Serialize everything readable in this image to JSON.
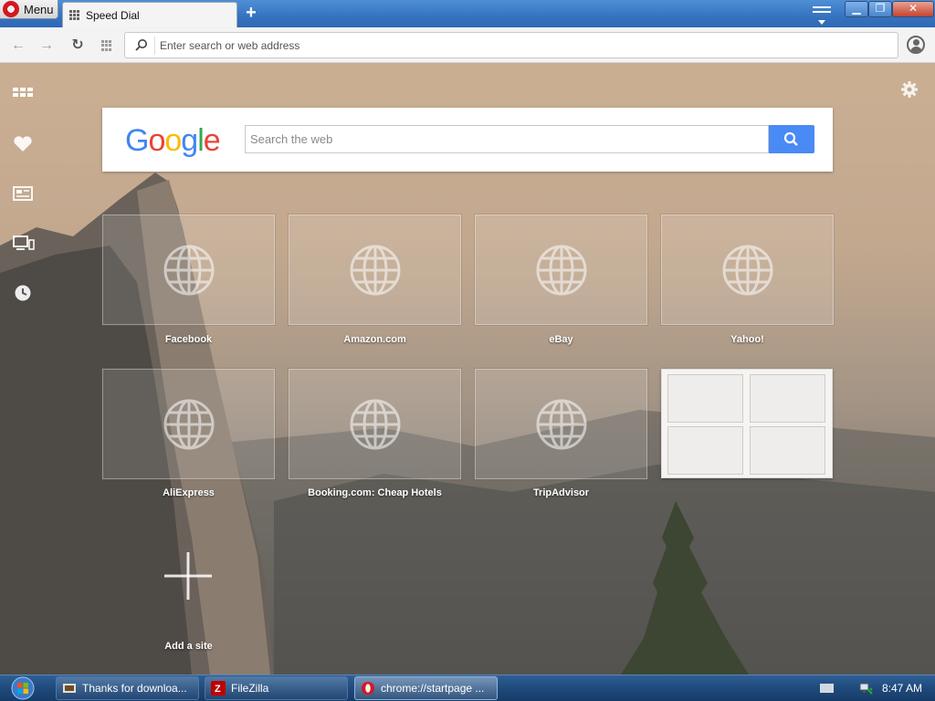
{
  "titlebar": {
    "menu_label": "Menu",
    "tab_title": "Speed Dial",
    "new_tab_symbol": "+",
    "window_buttons": {
      "minimize": "▁",
      "maximize": "❐",
      "close": "✕"
    }
  },
  "toolbar": {
    "back_symbol": "←",
    "forward_symbol": "→",
    "reload_symbol": "↻",
    "address_placeholder": "Enter search or web address"
  },
  "sidebar": {
    "items": [
      {
        "icon": "speed-dial-grid-icon"
      },
      {
        "icon": "heart-icon"
      },
      {
        "icon": "news-icon"
      },
      {
        "icon": "devices-icon"
      },
      {
        "icon": "history-clock-icon"
      }
    ]
  },
  "search": {
    "logo_letters": [
      "G",
      "o",
      "o",
      "g",
      "l",
      "e"
    ],
    "logo_colors": [
      "#4285f4",
      "#ea4335",
      "#fbbc05",
      "#4285f4",
      "#34a853",
      "#ea4335"
    ],
    "placeholder": "Search the web",
    "button_color": "#4a8af4"
  },
  "speed_dial": {
    "tiles": [
      {
        "label": "Facebook"
      },
      {
        "label": "Amazon.com"
      },
      {
        "label": "eBay"
      },
      {
        "label": "Yahoo!"
      },
      {
        "label": "AliExpress"
      },
      {
        "label": "Booking.com: Cheap Hotels"
      },
      {
        "label": "TripAdvisor"
      }
    ],
    "add_site_label": "Add a site"
  },
  "taskbar": {
    "buttons": [
      {
        "label": "Thanks for downloa...",
        "icon": "filezilla-download-icon"
      },
      {
        "label": "FileZilla",
        "icon": "filezilla-icon"
      },
      {
        "label": "chrome://startpage ...",
        "icon": "opera-icon"
      }
    ],
    "clock": "8:47 AM"
  }
}
